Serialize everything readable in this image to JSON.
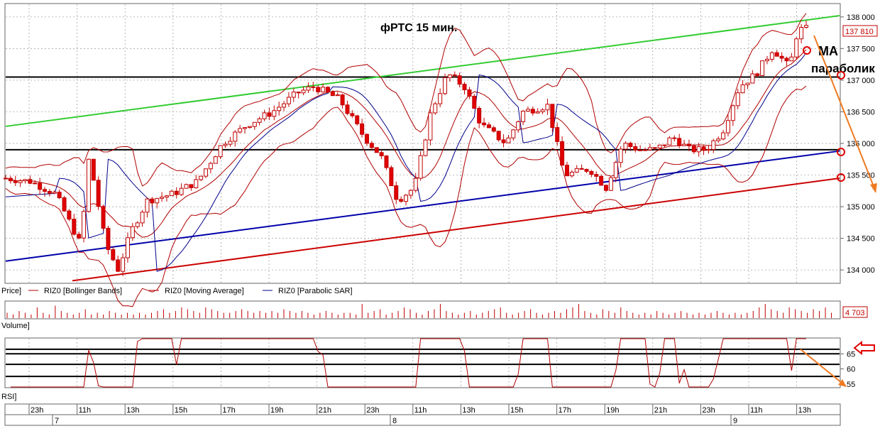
{
  "chart_data": {
    "type": "candlestick",
    "title": "фРТС   15 мин.",
    "ylim": [
      133800,
      138200
    ],
    "price_yticks": [
      134000,
      134500,
      135000,
      135500,
      136000,
      136500,
      137000,
      137500,
      138000
    ],
    "current_price": 137810,
    "current_price_label": "137 810",
    "legend": {
      "price": "Price]",
      "items": [
        {
          "label": "RIZ0 [Bollinger Bands]",
          "color": "#b00000"
        },
        {
          "label": "RIZ0 [Moving Average]",
          "color": "#b00000"
        },
        {
          "label": "RIZ0 [Parabolic SAR]",
          "color": "#00008b"
        }
      ]
    },
    "annotations": {
      "ma_label": "МА",
      "parabolic_label": "параболик"
    },
    "horizontal_levels": [
      137050,
      135900
    ],
    "trendlines": [
      {
        "name": "green",
        "color": "#33cc33",
        "from": [
          0,
          136270
        ],
        "to": [
          1,
          138020
        ]
      },
      {
        "name": "blue",
        "color": "#0000aa",
        "from": [
          0,
          134140
        ],
        "to": [
          1,
          135880
        ]
      },
      {
        "name": "red",
        "color": "#cc0000",
        "from": [
          0.08,
          133830
        ],
        "to": [
          1,
          135450
        ]
      }
    ],
    "volume": {
      "label": "Volume]",
      "last_value_label": "4 703",
      "values": [
        3,
        2,
        4,
        3,
        2,
        6,
        3,
        2,
        7,
        4,
        3,
        2,
        3,
        5,
        2,
        3,
        2,
        4,
        3,
        2,
        3,
        2,
        3,
        2,
        3,
        4,
        5,
        3,
        4,
        6,
        5,
        4,
        3,
        6,
        5,
        4,
        3,
        3,
        4,
        5,
        4,
        3,
        4,
        3,
        4,
        3,
        5,
        4,
        3,
        4,
        3,
        2,
        3,
        4,
        3,
        2,
        3,
        3,
        2,
        8,
        3,
        4,
        5,
        2,
        3,
        4,
        6,
        5,
        3,
        2,
        4,
        5,
        8,
        4,
        3,
        2,
        3,
        4,
        2,
        3,
        4,
        5,
        6,
        3,
        2,
        3,
        4,
        5,
        3,
        2,
        3,
        4,
        3,
        5,
        6,
        8,
        4,
        3,
        2,
        5,
        4,
        3,
        6,
        4,
        3,
        2,
        3,
        2,
        4,
        3,
        2,
        3,
        4,
        3,
        2,
        3,
        2,
        3,
        4,
        3,
        2,
        3,
        2,
        3,
        4,
        6,
        8,
        5,
        4,
        3,
        6,
        5,
        4,
        3,
        5,
        4,
        6,
        3
      ]
    },
    "rsi": {
      "label": "RSI]",
      "yticks": [
        55,
        60,
        65
      ],
      "levels": [
        66.5,
        65,
        61.5,
        57.5
      ],
      "ylim": [
        54,
        70
      ]
    },
    "time_axis": {
      "hour_labels": [
        "23h",
        "11h",
        "13h",
        "15h",
        "17h",
        "19h",
        "21h",
        "23h",
        "11h",
        "13h",
        "15h",
        "17h",
        "19h",
        "21h",
        "23h",
        "11h",
        "13h"
      ],
      "day_labels": [
        "7",
        "8",
        "9"
      ]
    }
  }
}
